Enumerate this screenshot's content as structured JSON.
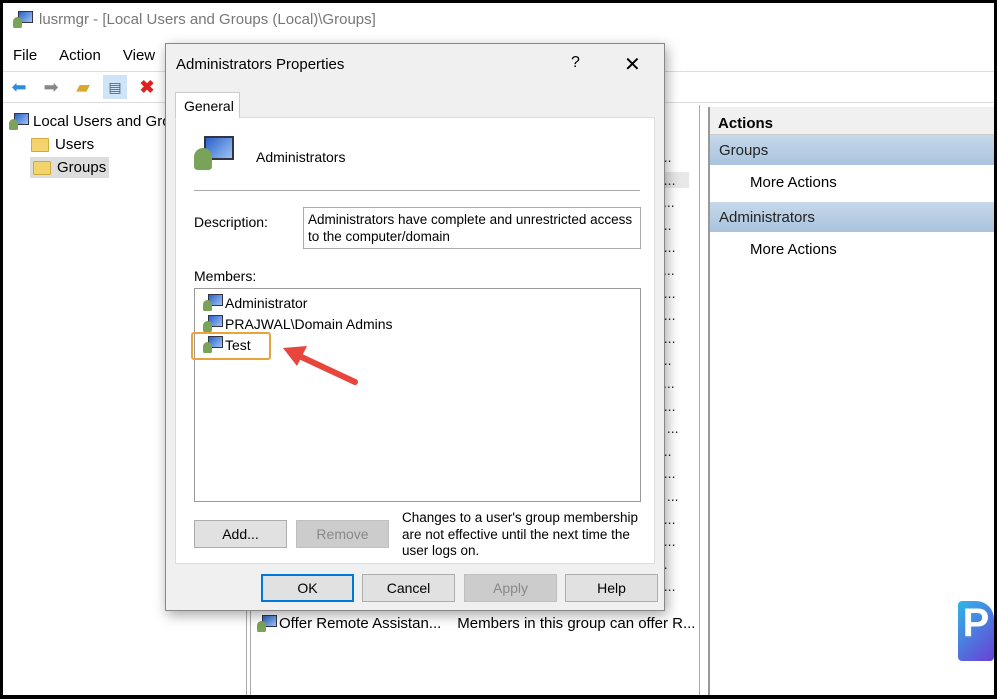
{
  "window": {
    "title": "lusrmgr - [Local Users and Groups (Local)\\Groups]"
  },
  "menu": [
    "File",
    "Action",
    "View"
  ],
  "tree": {
    "root": "Local Users and Grou",
    "items": [
      "Users",
      "Groups"
    ]
  },
  "list": {
    "fragments": [
      "t...",
      "d...",
      "c...",
      "r...",
      "g...",
      "c...",
      "e...",
      "n...",
      "p...",
      "f...",
      "s...",
      "d...",
      "s ...",
      "t...",
      "e...",
      "s ...",
      "a...",
      "g...",
      "...",
      "n..."
    ],
    "last_row": {
      "name": "Offer Remote Assistan...",
      "description": "Members in this group can offer R..."
    }
  },
  "actions": {
    "header": "Actions",
    "sections": [
      {
        "title": "Groups",
        "item": "More Actions"
      },
      {
        "title": "Administrators",
        "item": "More Actions"
      }
    ]
  },
  "dialog": {
    "title": "Administrators Properties",
    "help": "?",
    "close": "✕",
    "tab": "General",
    "group_name": "Administrators",
    "description_label": "Description:",
    "description": "Administrators have complete and unrestricted access to the computer/domain",
    "members_label": "Members:",
    "members": [
      "Administrator",
      "PRAJWAL\\Domain Admins",
      "Test"
    ],
    "add": "Add...",
    "remove": "Remove",
    "note": "Changes to a user's group membership are not effective until the next time the user logs on.",
    "ok": "OK",
    "cancel": "Cancel",
    "apply": "Apply",
    "help_btn": "Help"
  },
  "colors": {
    "highlight": "#e8a33a",
    "arrow": "#e8453c",
    "accent": "#0078d7"
  }
}
